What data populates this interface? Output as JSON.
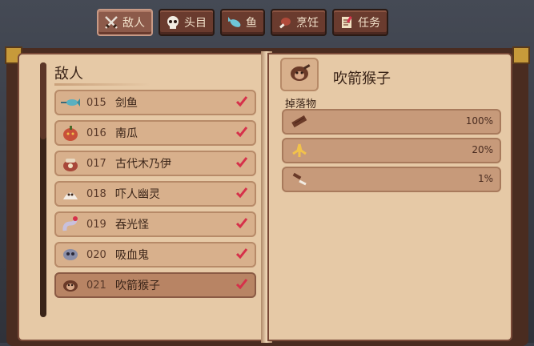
{
  "tabs": [
    {
      "label": "敌人",
      "icon": "crossed-swords-icon",
      "active": true
    },
    {
      "label": "头目",
      "icon": "skull-icon",
      "active": false
    },
    {
      "label": "鱼",
      "icon": "fish-icon",
      "active": false
    },
    {
      "label": "烹饪",
      "icon": "meat-icon",
      "active": false
    },
    {
      "label": "任务",
      "icon": "quest-scroll-icon",
      "active": false
    }
  ],
  "left_page": {
    "heading": "敌人",
    "entries": [
      {
        "number": "015",
        "name": "剑鱼",
        "icon": "swordfish-icon",
        "checked": true
      },
      {
        "number": "016",
        "name": "南瓜",
        "icon": "pumpkin-icon",
        "checked": true
      },
      {
        "number": "017",
        "name": "古代木乃伊",
        "icon": "mummy-pot-icon",
        "checked": true
      },
      {
        "number": "018",
        "name": "吓人幽灵",
        "icon": "ghost-icon",
        "checked": true
      },
      {
        "number": "019",
        "name": "吞光怪",
        "icon": "worm-icon",
        "checked": true
      },
      {
        "number": "020",
        "name": "吸血鬼",
        "icon": "vampire-icon",
        "checked": true
      },
      {
        "number": "021",
        "name": "吹箭猴子",
        "icon": "monkey-icon",
        "checked": true,
        "selected": true
      }
    ]
  },
  "right_page": {
    "title": "吹箭猴子",
    "portrait_icon": "monkey-icon",
    "drops_label": "掉落物",
    "drops": [
      {
        "icon": "wood-plank-icon",
        "chance": "100%"
      },
      {
        "icon": "banana-icon",
        "chance": "20%"
      },
      {
        "icon": "blowgun-icon",
        "chance": "1%"
      }
    ]
  },
  "colors": {
    "page": "#e6c9a6",
    "row": "#d8b08c",
    "row_selected": "#b88464",
    "check": "#d6304a",
    "tab": "#6a3b2e"
  }
}
